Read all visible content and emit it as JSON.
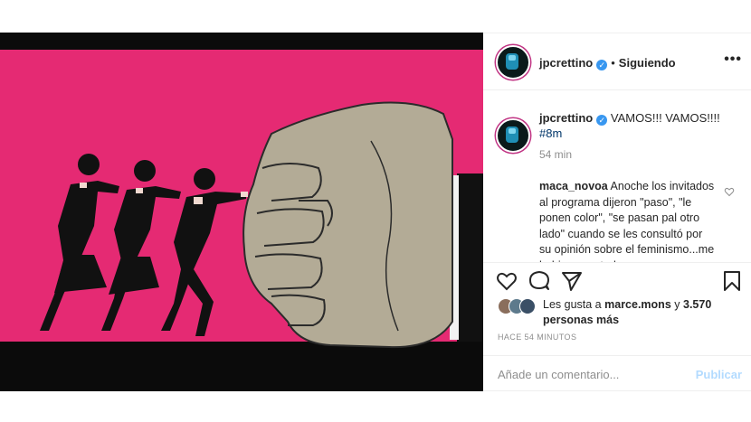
{
  "header": {
    "username": "jpcrettino",
    "separator": "•",
    "follow_status": "Siguiendo",
    "more_label": "•••"
  },
  "caption": {
    "username": "jpcrettino",
    "text": "VAMOS!!! VAMOS!!!!",
    "hashtag": "#8m",
    "time": "54 min"
  },
  "comment": {
    "username": "maca_novoa",
    "text": "Anoche los invitados al programa dijeron \"paso\", \"le ponen color\", \"se pasan pal otro lado\" cuando se les consultó por su opinión sobre el feminismo...me hubiese gustado"
  },
  "likes": {
    "prefix": "Les gusta a",
    "user": "marce.mons",
    "connector": "y",
    "count": "3.570 personas más"
  },
  "time_ago": "HACE 54 MINUTOS",
  "add_comment": {
    "placeholder": "Añade un comentario...",
    "publish": "Publicar"
  },
  "colors": {
    "background_pink": "#e52a73",
    "fist": "#b3ab96",
    "suit": "#111111",
    "verified": "#3897f0",
    "link": "#003569"
  },
  "icons": [
    "verified-badge-icon",
    "heart-icon",
    "comment-icon",
    "share-icon",
    "bookmark-icon"
  ]
}
